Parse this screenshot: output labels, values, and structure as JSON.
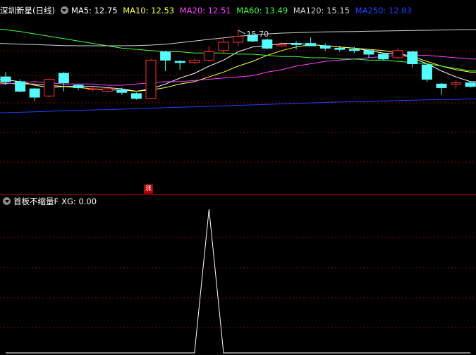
{
  "main_panel": {
    "stock_name": "深圳新星",
    "period": "(日线)",
    "indicators": [
      {
        "label": "MA5: 12.75",
        "color": "#ffffff"
      },
      {
        "label": "MA10: 12.53",
        "color": "#ffff40"
      },
      {
        "label": "MA20: 12.51",
        "color": "#ff40ff"
      },
      {
        "label": "MA60: 13.49",
        "color": "#40ff40"
      },
      {
        "label": "MA120: 15.15",
        "color": "#d0d0d0"
      },
      {
        "label": "MA250: 12.83",
        "color": "#2040ff"
      }
    ],
    "high_marker": "15.70",
    "limit_up_marker": "涨"
  },
  "indicator_panel": {
    "name": "首板不缩量F",
    "value_label": "XG: 0.00"
  },
  "colors": {
    "up": "#ff3232",
    "down": "#54fcfc",
    "grid": "#8b0000",
    "divider": "#b00000"
  },
  "chart_data": {
    "type": "candlestick",
    "y_range": [
      9.6,
      16.2
    ],
    "candles": [
      {
        "o": 13.75,
        "h": 13.95,
        "l": 13.4,
        "c": 13.55
      },
      {
        "o": 13.55,
        "h": 13.65,
        "l": 13.1,
        "c": 13.15
      },
      {
        "o": 13.25,
        "h": 13.3,
        "l": 12.75,
        "c": 12.9
      },
      {
        "o": 12.95,
        "h": 13.7,
        "l": 12.9,
        "c": 13.65
      },
      {
        "o": 13.9,
        "h": 13.95,
        "l": 13.15,
        "c": 13.5
      },
      {
        "o": 13.4,
        "h": 13.45,
        "l": 13.2,
        "c": 13.3
      },
      {
        "o": 13.25,
        "h": 13.35,
        "l": 13.15,
        "c": 13.25
      },
      {
        "o": 13.15,
        "h": 13.3,
        "l": 13.1,
        "c": 13.25
      },
      {
        "o": 13.2,
        "h": 13.3,
        "l": 13.0,
        "c": 13.1
      },
      {
        "o": 13.05,
        "h": 13.1,
        "l": 12.8,
        "c": 12.85
      },
      {
        "o": 12.85,
        "h": 14.5,
        "l": 12.85,
        "c": 14.45
      },
      {
        "o": 14.8,
        "h": 14.85,
        "l": 14.0,
        "c": 14.45
      },
      {
        "o": 14.4,
        "h": 14.45,
        "l": 14.05,
        "c": 14.35
      },
      {
        "o": 14.35,
        "h": 14.5,
        "l": 14.3,
        "c": 14.45
      },
      {
        "o": 14.45,
        "h": 15.05,
        "l": 14.4,
        "c": 14.8
      },
      {
        "o": 14.85,
        "h": 15.35,
        "l": 14.75,
        "c": 15.2
      },
      {
        "o": 15.2,
        "h": 15.7,
        "l": 15.05,
        "c": 15.45
      },
      {
        "o": 15.5,
        "h": 15.55,
        "l": 15.2,
        "c": 15.25
      },
      {
        "o": 15.3,
        "h": 15.35,
        "l": 14.9,
        "c": 14.95
      },
      {
        "o": 15.05,
        "h": 15.2,
        "l": 15.0,
        "c": 15.1
      },
      {
        "o": 15.15,
        "h": 15.25,
        "l": 14.9,
        "c": 15.1
      },
      {
        "o": 15.15,
        "h": 15.4,
        "l": 15.05,
        "c": 15.05
      },
      {
        "o": 15.05,
        "h": 15.15,
        "l": 14.85,
        "c": 14.95
      },
      {
        "o": 14.95,
        "h": 15.05,
        "l": 14.8,
        "c": 14.9
      },
      {
        "o": 14.9,
        "h": 15.0,
        "l": 14.75,
        "c": 14.85
      },
      {
        "o": 14.85,
        "h": 14.9,
        "l": 14.55,
        "c": 14.7
      },
      {
        "o": 14.7,
        "h": 14.75,
        "l": 14.45,
        "c": 14.5
      },
      {
        "o": 14.55,
        "h": 14.95,
        "l": 14.5,
        "c": 14.85
      },
      {
        "o": 14.8,
        "h": 14.85,
        "l": 14.15,
        "c": 14.3
      },
      {
        "o": 14.25,
        "h": 14.3,
        "l": 13.55,
        "c": 13.65
      },
      {
        "o": 13.45,
        "h": 13.5,
        "l": 13.0,
        "c": 13.3
      },
      {
        "o": 13.45,
        "h": 13.6,
        "l": 13.25,
        "c": 13.5
      },
      {
        "o": 13.5,
        "h": 13.55,
        "l": 13.3,
        "c": 13.35
      }
    ],
    "ma_series": [
      {
        "name": "MA5",
        "color": "#ffffff",
        "values": [
          13.65,
          13.55,
          13.4,
          13.3,
          13.35,
          13.35,
          13.35,
          13.3,
          13.25,
          13.15,
          13.25,
          13.45,
          13.7,
          13.9,
          14.2,
          14.45,
          14.8,
          15.0,
          15.05,
          15.15,
          15.15,
          15.1,
          15.05,
          15.0,
          14.95,
          14.85,
          14.75,
          14.7,
          14.55,
          14.3,
          14.0,
          13.75,
          13.55
        ]
      },
      {
        "name": "MA10",
        "color": "#ffff40",
        "values": [
          13.5,
          13.45,
          13.45,
          13.4,
          13.35,
          13.3,
          13.25,
          13.2,
          13.2,
          13.15,
          13.2,
          13.3,
          13.45,
          13.55,
          13.75,
          13.95,
          14.2,
          14.4,
          14.65,
          14.85,
          15.0,
          15.1,
          15.05,
          15.0,
          14.95,
          14.9,
          14.85,
          14.75,
          14.6,
          14.4,
          14.2,
          14.05,
          13.95
        ]
      },
      {
        "name": "MA20",
        "color": "#ff40ff",
        "values": [
          13.45,
          13.5,
          13.55,
          13.5,
          13.45,
          13.45,
          13.45,
          13.4,
          13.4,
          13.45,
          13.5,
          13.55,
          13.55,
          13.6,
          13.65,
          13.7,
          13.75,
          13.8,
          13.95,
          14.05,
          14.2,
          14.3,
          14.4,
          14.45,
          14.5,
          14.55,
          14.6,
          14.65,
          14.65,
          14.65,
          14.6,
          14.55,
          14.5
        ]
      },
      {
        "name": "MA60",
        "color": "#40ff40",
        "values": [
          15.75,
          15.65,
          15.55,
          15.45,
          15.35,
          15.25,
          15.15,
          15.05,
          14.95,
          14.9,
          14.85,
          14.8,
          14.8,
          14.75,
          14.75,
          14.75,
          14.7,
          14.7,
          14.65,
          14.6,
          14.6,
          14.55,
          14.55,
          14.5,
          14.5,
          14.45,
          14.45,
          14.4,
          14.35,
          14.3,
          14.2,
          14.1,
          14.0
        ]
      },
      {
        "name": "MA120",
        "color": "#d0d0d0",
        "values": [
          15.15,
          15.12,
          15.1,
          15.08,
          15.06,
          15.05,
          15.05,
          15.05,
          15.05,
          15.06,
          15.08,
          15.12,
          15.18,
          15.25,
          15.32,
          15.38,
          15.45,
          15.5,
          15.55,
          15.58,
          15.6,
          15.62,
          15.63,
          15.64,
          15.65,
          15.66,
          15.67,
          15.68,
          15.69,
          15.7,
          15.71,
          15.72,
          15.73
        ]
      },
      {
        "name": "MA250",
        "color": "#2040ff",
        "values": [
          12.25,
          12.27,
          12.29,
          12.31,
          12.33,
          12.35,
          12.37,
          12.38,
          12.4,
          12.42,
          12.44,
          12.46,
          12.48,
          12.5,
          12.52,
          12.54,
          12.56,
          12.58,
          12.6,
          12.62,
          12.64,
          12.66,
          12.68,
          12.7,
          12.71,
          12.72,
          12.74,
          12.76,
          12.77,
          12.79,
          12.8,
          12.81,
          12.83
        ]
      }
    ],
    "indicator_series": {
      "name": "XG",
      "y_range": [
        0,
        1
      ],
      "values": [
        0,
        0,
        0,
        0,
        0,
        0,
        0,
        0,
        0,
        0,
        0,
        0,
        0,
        0,
        1,
        0,
        0,
        0,
        0,
        0,
        0,
        0,
        0,
        0,
        0,
        0,
        0,
        0,
        0,
        0,
        0,
        0,
        0
      ]
    }
  }
}
